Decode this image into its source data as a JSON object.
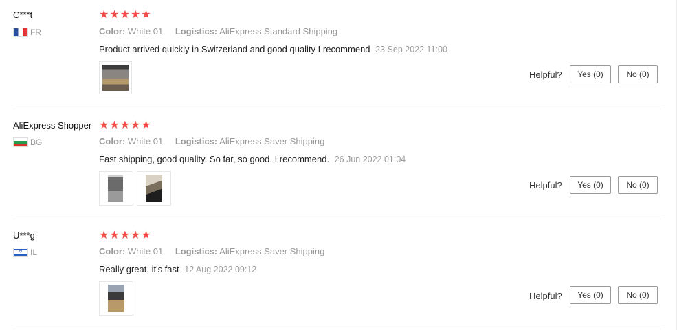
{
  "reviews": [
    {
      "user": "C***t",
      "country": "FR",
      "stars": "★★★★★",
      "color_label": "Color:",
      "color_value": "White 01",
      "logistics_label": "Logistics:",
      "logistics_value": "AliExpress Standard Shipping",
      "text": "Product arrived quickly in Switzerland and good quality I recommend",
      "date": "23 Sep 2022 11:00",
      "helpful_label": "Helpful?",
      "yes_label": "Yes (0)",
      "no_label": "No (0)"
    },
    {
      "user": "AliExpress Shopper",
      "country": "BG",
      "stars": "★★★★★",
      "color_label": "Color:",
      "color_value": "White 01",
      "logistics_label": "Logistics:",
      "logistics_value": "AliExpress Saver Shipping",
      "text": "Fast shipping, good quality. So far, so good. I recommend.",
      "date": "26 Jun 2022 01:04",
      "helpful_label": "Helpful?",
      "yes_label": "Yes (0)",
      "no_label": "No (0)"
    },
    {
      "user": "U***g",
      "country": "IL",
      "stars": "★★★★★",
      "color_label": "Color:",
      "color_value": "White 01",
      "logistics_label": "Logistics:",
      "logistics_value": "AliExpress Saver Shipping",
      "text": "Really great, it's fast",
      "date": "12 Aug 2022 09:12",
      "helpful_label": "Helpful?",
      "yes_label": "Yes (0)",
      "no_label": "No (0)"
    }
  ],
  "colors": {
    "star": "#f44a4a",
    "muted": "#999999"
  }
}
